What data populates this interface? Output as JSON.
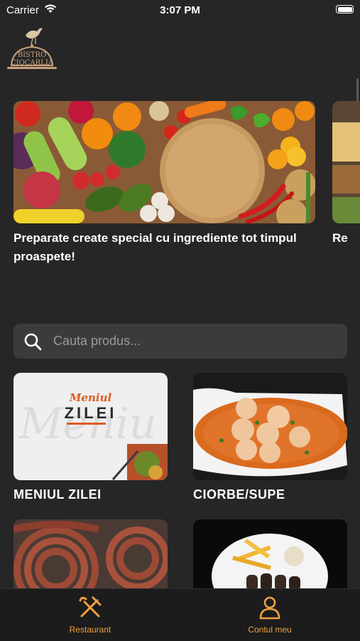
{
  "status_bar": {
    "carrier": "Carrier",
    "time": "3:07 PM"
  },
  "brand": {
    "logo_line1": "BISTRO",
    "logo_line2": "CIOCARLIA",
    "logo_color": "#c9a27a"
  },
  "banners": [
    {
      "title": "Preparate create special cu ingrediente tot timpul proaspete!"
    },
    {
      "title": "Re"
    }
  ],
  "search": {
    "placeholder": "Cauta produs..."
  },
  "categories": [
    {
      "label": "MENIUL ZILEI",
      "image_script": "Meniul",
      "image_word": "ZILEI"
    },
    {
      "label": "CIORBE/SUPE"
    },
    {
      "label": ""
    },
    {
      "label": ""
    }
  ],
  "tab_bar": {
    "items": [
      {
        "label": "Restaurant",
        "icon": "fork-knife-icon"
      },
      {
        "label": "Contul meu",
        "icon": "user-icon"
      }
    ],
    "accent": "#f0a040"
  },
  "colors": {
    "background": "#262626",
    "search_bg": "#3b3b3b",
    "tab_bg": "#1c1c1c"
  }
}
